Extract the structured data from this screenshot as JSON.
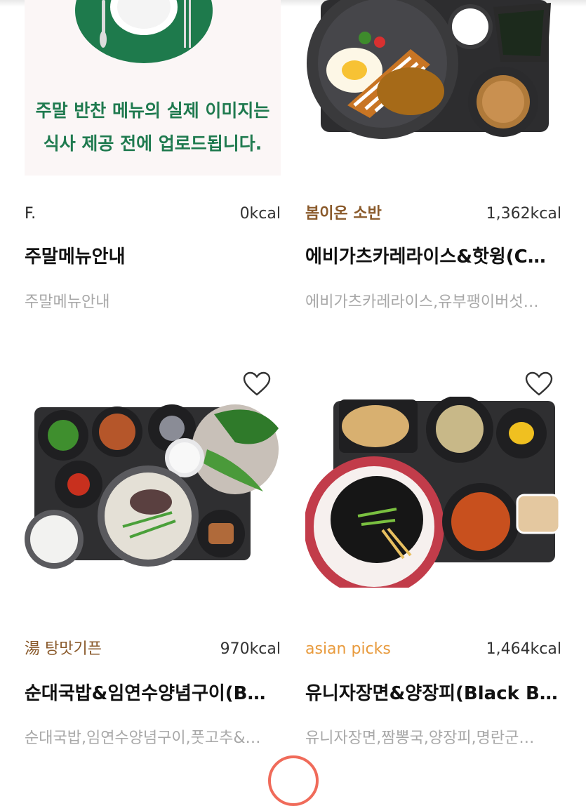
{
  "menus": [
    {
      "brand": "F.",
      "kcal": "0kcal",
      "title": "주말메뉴안내",
      "desc": "주말메뉴안내",
      "notice_line1": "주말 반찬 메뉴의 실제 이미지는",
      "notice_line2": "식사 제공 전에 업로드됩니다.",
      "favorite": false
    },
    {
      "brand": "봄이온 소반",
      "kcal": "1,362kcal",
      "title": "에비가츠카레라이스&핫윙(C…",
      "desc": "에비가츠카레라이스,유부팽이버섯…",
      "favorite": false
    },
    {
      "brand": "湯 탕맛기픈",
      "kcal": "970kcal",
      "title": "순대국밥&임연수양념구이(B…",
      "desc": "순대국밥,임연수양념구이,풋고추&…",
      "favorite": false
    },
    {
      "brand": "asian picks",
      "kcal": "1,464kcal",
      "title": "유니자장면&양장피(Black B…",
      "desc": "유니자장면,짬뽕국,양장피,명란군…",
      "favorite": false
    }
  ],
  "colors": {
    "notice_green": "#1f7a4f",
    "brand_brown": "#8a5a2b",
    "asian_orange": "#e89a3c",
    "fab_ring": "#f06b5a"
  },
  "icons": {
    "favorite": "heart-outline-icon"
  }
}
